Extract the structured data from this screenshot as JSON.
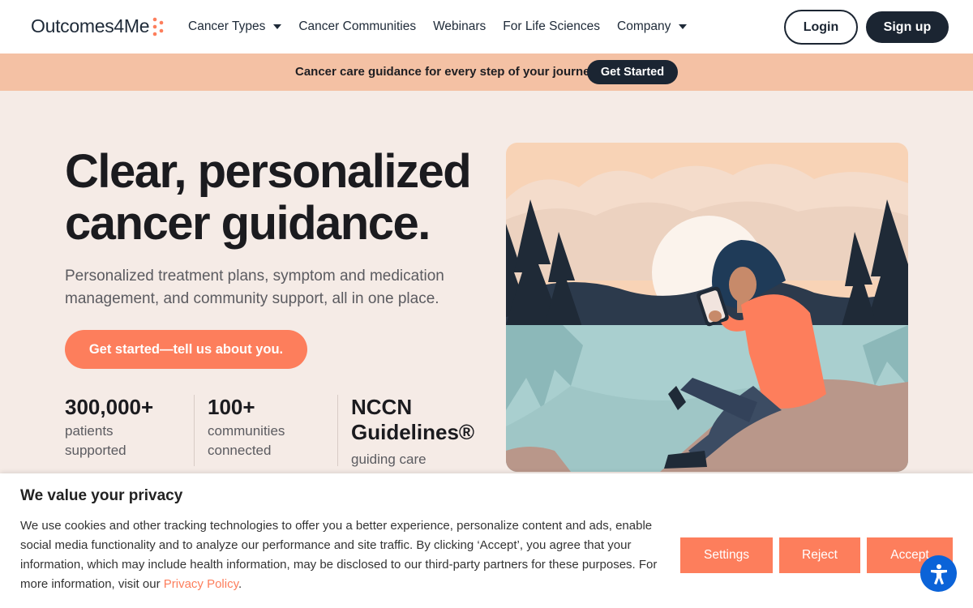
{
  "brand": {
    "name": "Outcomes4Me",
    "accent": "#fd7e5c",
    "navy": "#1b2532",
    "promo_bg": "#f4c1a4",
    "hero_bg": "#f5ebe6"
  },
  "nav": {
    "items": [
      {
        "label": "Cancer Types",
        "has_dropdown": true
      },
      {
        "label": "Cancer Communities",
        "has_dropdown": false
      },
      {
        "label": "Webinars",
        "has_dropdown": false
      },
      {
        "label": "For Life Sciences",
        "has_dropdown": false
      },
      {
        "label": "Company",
        "has_dropdown": true
      }
    ],
    "login_label": "Login",
    "signup_label": "Sign up"
  },
  "promo": {
    "text": "Cancer care guidance for every step of your journey",
    "button_label": "Get Started"
  },
  "hero": {
    "title_line1": "Clear, personalized",
    "title_line2": "cancer guidance.",
    "subtitle": "Personalized treatment plans, symptom and medication management, and community support, all in one place.",
    "cta_label": "Get started—tell us about you."
  },
  "stats": [
    {
      "number": "300,000+",
      "label_line1": "patients",
      "label_line2": "supported"
    },
    {
      "number": "100+",
      "label_line1": "communities",
      "label_line2": "connected"
    },
    {
      "number_line1": "NCCN",
      "number_line2": "Guidelines®",
      "label_line1": "guiding care"
    }
  ],
  "cookie": {
    "title": "We value your privacy",
    "body": "We use cookies and other tracking technologies to offer you a better experience, personalize content and ads, enable social media functionality and to analyze our performance and site traffic. By clicking ‘Accept’, you agree that your information, which may include health information, may be disclosed to our third-party partners for these purposes. For more information, visit our ",
    "link_label": "Privacy Policy",
    "body_end": ".",
    "settings_label": "Settings",
    "reject_label": "Reject",
    "accept_label": "Accept"
  },
  "icons": {
    "logo_mark": "dots-logo-icon",
    "accessibility": "accessibility-icon",
    "illustration": "woman-reading-phone-by-lake-illustration"
  }
}
